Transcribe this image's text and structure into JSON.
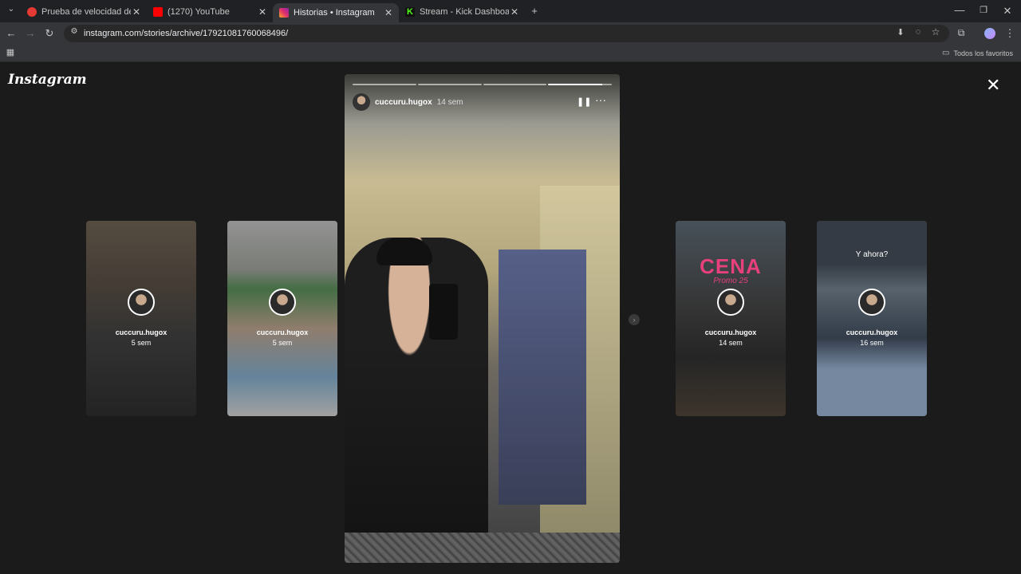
{
  "browser": {
    "tabs": [
      {
        "title": "Prueba de velocidad de Interne",
        "favicon_color": "#e53935"
      },
      {
        "title": "(1270) YouTube",
        "favicon_color": "#ff0000"
      },
      {
        "title": "Historias • Instagram",
        "favicon_color": "#e1306c"
      },
      {
        "title": "Stream - Kick Dashboard",
        "favicon_color": "#53fc18"
      }
    ],
    "url": "instagram.com/stories/archive/17921081760068496/",
    "bookmarks_label": "Todos los favoritos"
  },
  "instagram": {
    "logo": "Instagram",
    "current_story": {
      "username": "cuccuru.hugox",
      "time": "14 sem"
    },
    "thumbnails": [
      {
        "username": "cuccuru.hugox",
        "time": "5 sem",
        "overlay": ""
      },
      {
        "username": "cuccuru.hugox",
        "time": "5 sem",
        "overlay": ""
      },
      {
        "username": "cuccuru.hugox",
        "time": "14 sem",
        "overlay": "CENA",
        "overlay_sub": "Promo 25"
      },
      {
        "username": "cuccuru.hugox",
        "time": "16 sem",
        "overlay": "Y ahora?"
      }
    ]
  },
  "colors": {
    "accent_neon": "#e8407a",
    "background": "#1b1b1b"
  }
}
